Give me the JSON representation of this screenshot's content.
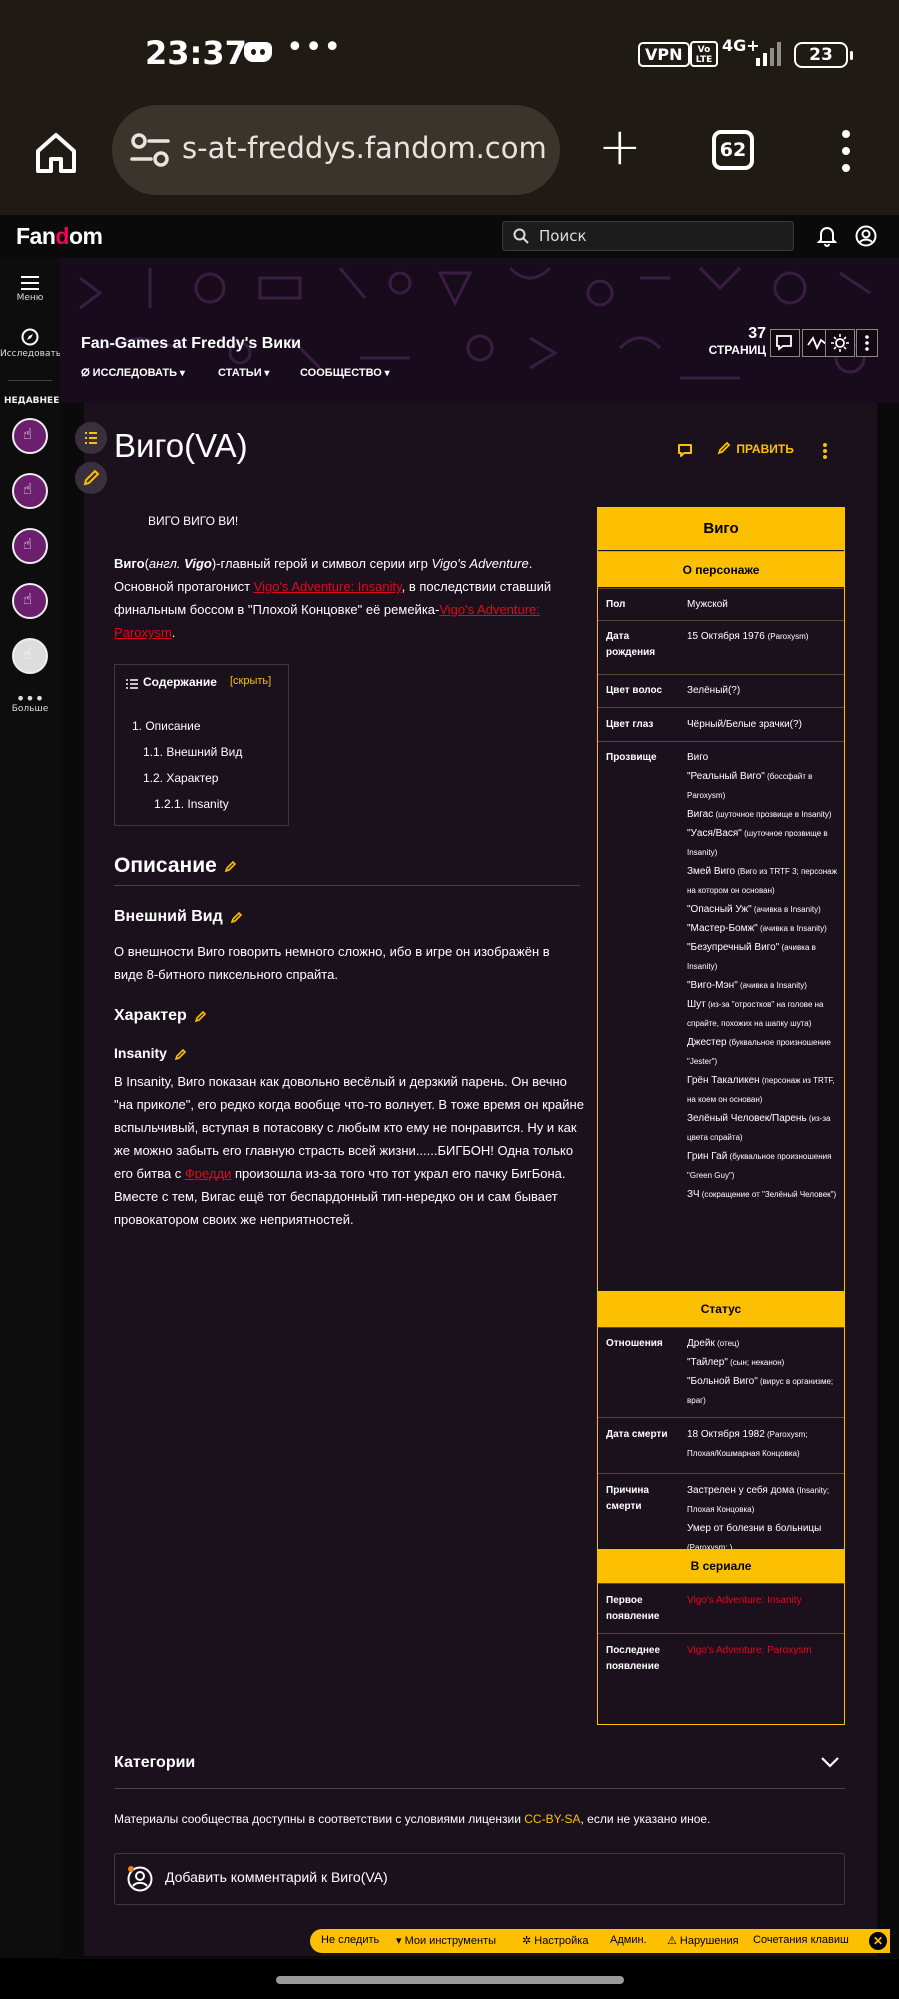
{
  "status_bar": {
    "time": "23:37",
    "more": "•••",
    "vpn": "VPN",
    "volte": "Vo LTE",
    "network": "4G+",
    "battery": "23"
  },
  "browser": {
    "url": "s-at-freddys.fandom.com",
    "tabs_count": "62"
  },
  "fandom": {
    "logo_left": "Fan",
    "logo_flame": "d",
    "logo_right": "om",
    "search_placeholder": "Поиск"
  },
  "rail": {
    "menu": "Меню",
    "explore": "Исследовать",
    "recent": "НЕДАВНЕЕ",
    "more": "Больше"
  },
  "wiki": {
    "title": "Fan-Games at Freddy's Вики",
    "nav": [
      "ИССЛЕДОВАТЬ",
      "СТАТЬИ",
      "СООБЩЕСТВО"
    ],
    "pages_count": "37",
    "pages_label": "СТРАНИЦ"
  },
  "page": {
    "title": "Виго(VA)",
    "edit_label": "ПРАВИТЬ",
    "quote": "ВИГО ВИГО ВИ!",
    "intro_name": "Виго",
    "intro_paren_lang": "англ.",
    "intro_paren_name": "Vigo",
    "intro_rest1": "-главный герой и символ серии игр ",
    "intro_game": "Vigo's Adventure",
    "intro_rest2": ". Основной протагонист ",
    "intro_link1": "Vigo's Adventure: Insanity",
    "intro_rest3": ", в последствии ставший финальным боссом в \"Плохой Концовке\" её ремейка-",
    "intro_link2": "Vigo's Adventure: Paroxysm",
    "intro_rest4": "."
  },
  "toc": {
    "title": "Содержание",
    "hide": "[скрыть]",
    "items": [
      "1.  Описание",
      "1.1.  Внешний Вид",
      "1.2.  Характер",
      "1.2.1.  Insanity"
    ]
  },
  "sections": {
    "description": "Описание",
    "appearance": "Внешний Вид",
    "appearance_text": "О внешности Виго говорить немного сложно, ибо в игре он изображён в виде 8-битного пиксельного спрайта.",
    "character": "Характер",
    "insanity": "Insanity",
    "insanity_text_a": "В Insanity, Виго показан как довольно весёлый и дерзкий парень. Он вечно \"на приколе\", его редко когда вообще что-то волнует. В тоже время он крайне вспыльчивый, вступая в потасовку с любым кто ему не понравится. Ну и как же можно забыть его главную страсть всей жизни......БИГБОН! Одна только его битва с ",
    "insanity_link": "Фредди",
    "insanity_text_b": " произошла из-за того что тот украл его пачку БигБона. Вместе с тем, Вигас ещё тот беспардонный тип-нередко он и сам бывает провокатором своих же неприятностей."
  },
  "infobox": {
    "title": "Виго",
    "section1": "О персонаже",
    "gender_label": "Пол",
    "gender": "Мужской",
    "birth_label": "Дата рождения",
    "birth": "15 Октября 1976",
    "birth_note": "(Paroxysm)",
    "hair_label": "Цвет волос",
    "hair": "Зелёный(?)",
    "eyes_label": "Цвет глаз",
    "eyes": "Чёрный/Белые зрачки(?)",
    "nick_label": "Прозвище",
    "nicknames": [
      [
        "Виго",
        ""
      ],
      [
        "\"Реальный Виго\"",
        " (боссфайт в Paroxysm)"
      ],
      [
        "Вигас",
        " (шуточное прозвище в Insanity)"
      ],
      [
        "\"Уася/Вася\"",
        " (шуточное прозвище в Insanity)"
      ],
      [
        "Змей Виго",
        " (Виго из TRTF 3; персонаж на котором он основан)"
      ],
      [
        "\"Опасный Уж\"",
        " (ачивка в Insanity)"
      ],
      [
        "\"Мастер-Бомж\"",
        " (ачивка в Insanity)"
      ],
      [
        "\"Безупречный Виго\"",
        " (ачивка в Insanity)"
      ],
      [
        "\"Виго-Мэн\"",
        " (ачивка в Insanity)"
      ],
      [
        "Шут",
        " (из-за \"отростков\" на голове на спрайте, похожих на шапку шута)"
      ],
      [
        "Джестер",
        " (буквальное произношение \"Jester\")"
      ],
      [
        "Грён Такаликен",
        " (персонаж из TRTF, на коем он основан)"
      ],
      [
        "Зелёный Человек/Парень",
        " (из-за цвета спрайта)"
      ],
      [
        "Грин Гай",
        " (буквальное произношения \"Green Guy\")"
      ],
      [
        "ЗЧ",
        " (сокращение от \"Зелёный Человек\")"
      ]
    ],
    "section2": "Статус",
    "rel_label": "Отношения",
    "relations": [
      [
        "Дрейк",
        " (отец)"
      ],
      [
        "\"Тайлер\"",
        " (сын; неканон)"
      ],
      [
        "\"Больной Виго\"",
        " (вирус в организме; враг)"
      ]
    ],
    "death_label": "Дата смерти",
    "death": "18 Октября 1982",
    "death_note": " (Paroxysm; Плохая/Кошмарная Концовка)",
    "cause_label": "Причина смерти",
    "cause1": "Застрелен у себя дома",
    "cause1_note": " (Insanity; Плохая Концовка)",
    "cause2": "Умер от болезни в больницы",
    "cause2_note": " (Paroxysm; )",
    "section3": "В сериале",
    "first_label": "Первое появление",
    "first": "Vigo's Adventure: Insanity",
    "last_label": "Последнее появление",
    "last": "Vigo's Adventure: Paroxysm"
  },
  "footer": {
    "categories": "Категории",
    "license_a": "Материалы сообщества доступны в соответствии с условиями лицензии ",
    "license_link": "CC-BY-SA",
    "license_b": ", если не указано иное.",
    "add_comment": "Добавить комментарий к Виго(VA)"
  },
  "toolbar": {
    "unfollow": "Не следить",
    "my_tools": "Мои инструменты",
    "settings": "Настройка",
    "admin": "Админ.",
    "violations": "Нарушения",
    "shortcuts": "Сочетания клавиш",
    "close": "✕"
  },
  "colors": {
    "accent": "#fcc000",
    "link": "#e4061d",
    "article_bg": "#1b111d",
    "fandom_pink": "#fa005a"
  }
}
